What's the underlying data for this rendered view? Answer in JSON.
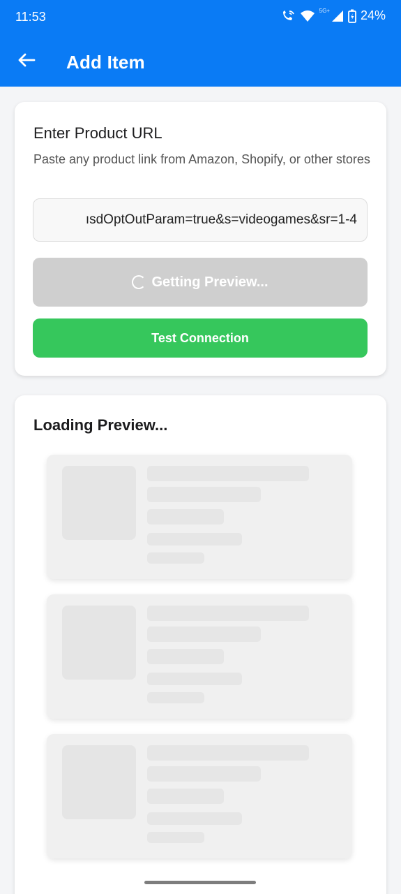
{
  "status": {
    "time": "11:53",
    "network": "5G+",
    "battery": "24%"
  },
  "toolbar": {
    "title": "Add Item",
    "back_icon": "arrow-left-icon"
  },
  "url_card": {
    "title": "Enter Product URL",
    "subtitle": "Paste any product link from Amazon, Shopify, or other stores",
    "input_value": "ısdOptOutParam=true&s=videogames&sr=1-4",
    "preview_button": "Getting Preview...",
    "test_button": "Test Connection"
  },
  "preview_card": {
    "title": "Loading Preview..."
  },
  "colors": {
    "primary": "#0a7bf5",
    "success": "#36c75c",
    "disabled": "#cfcfcf"
  }
}
